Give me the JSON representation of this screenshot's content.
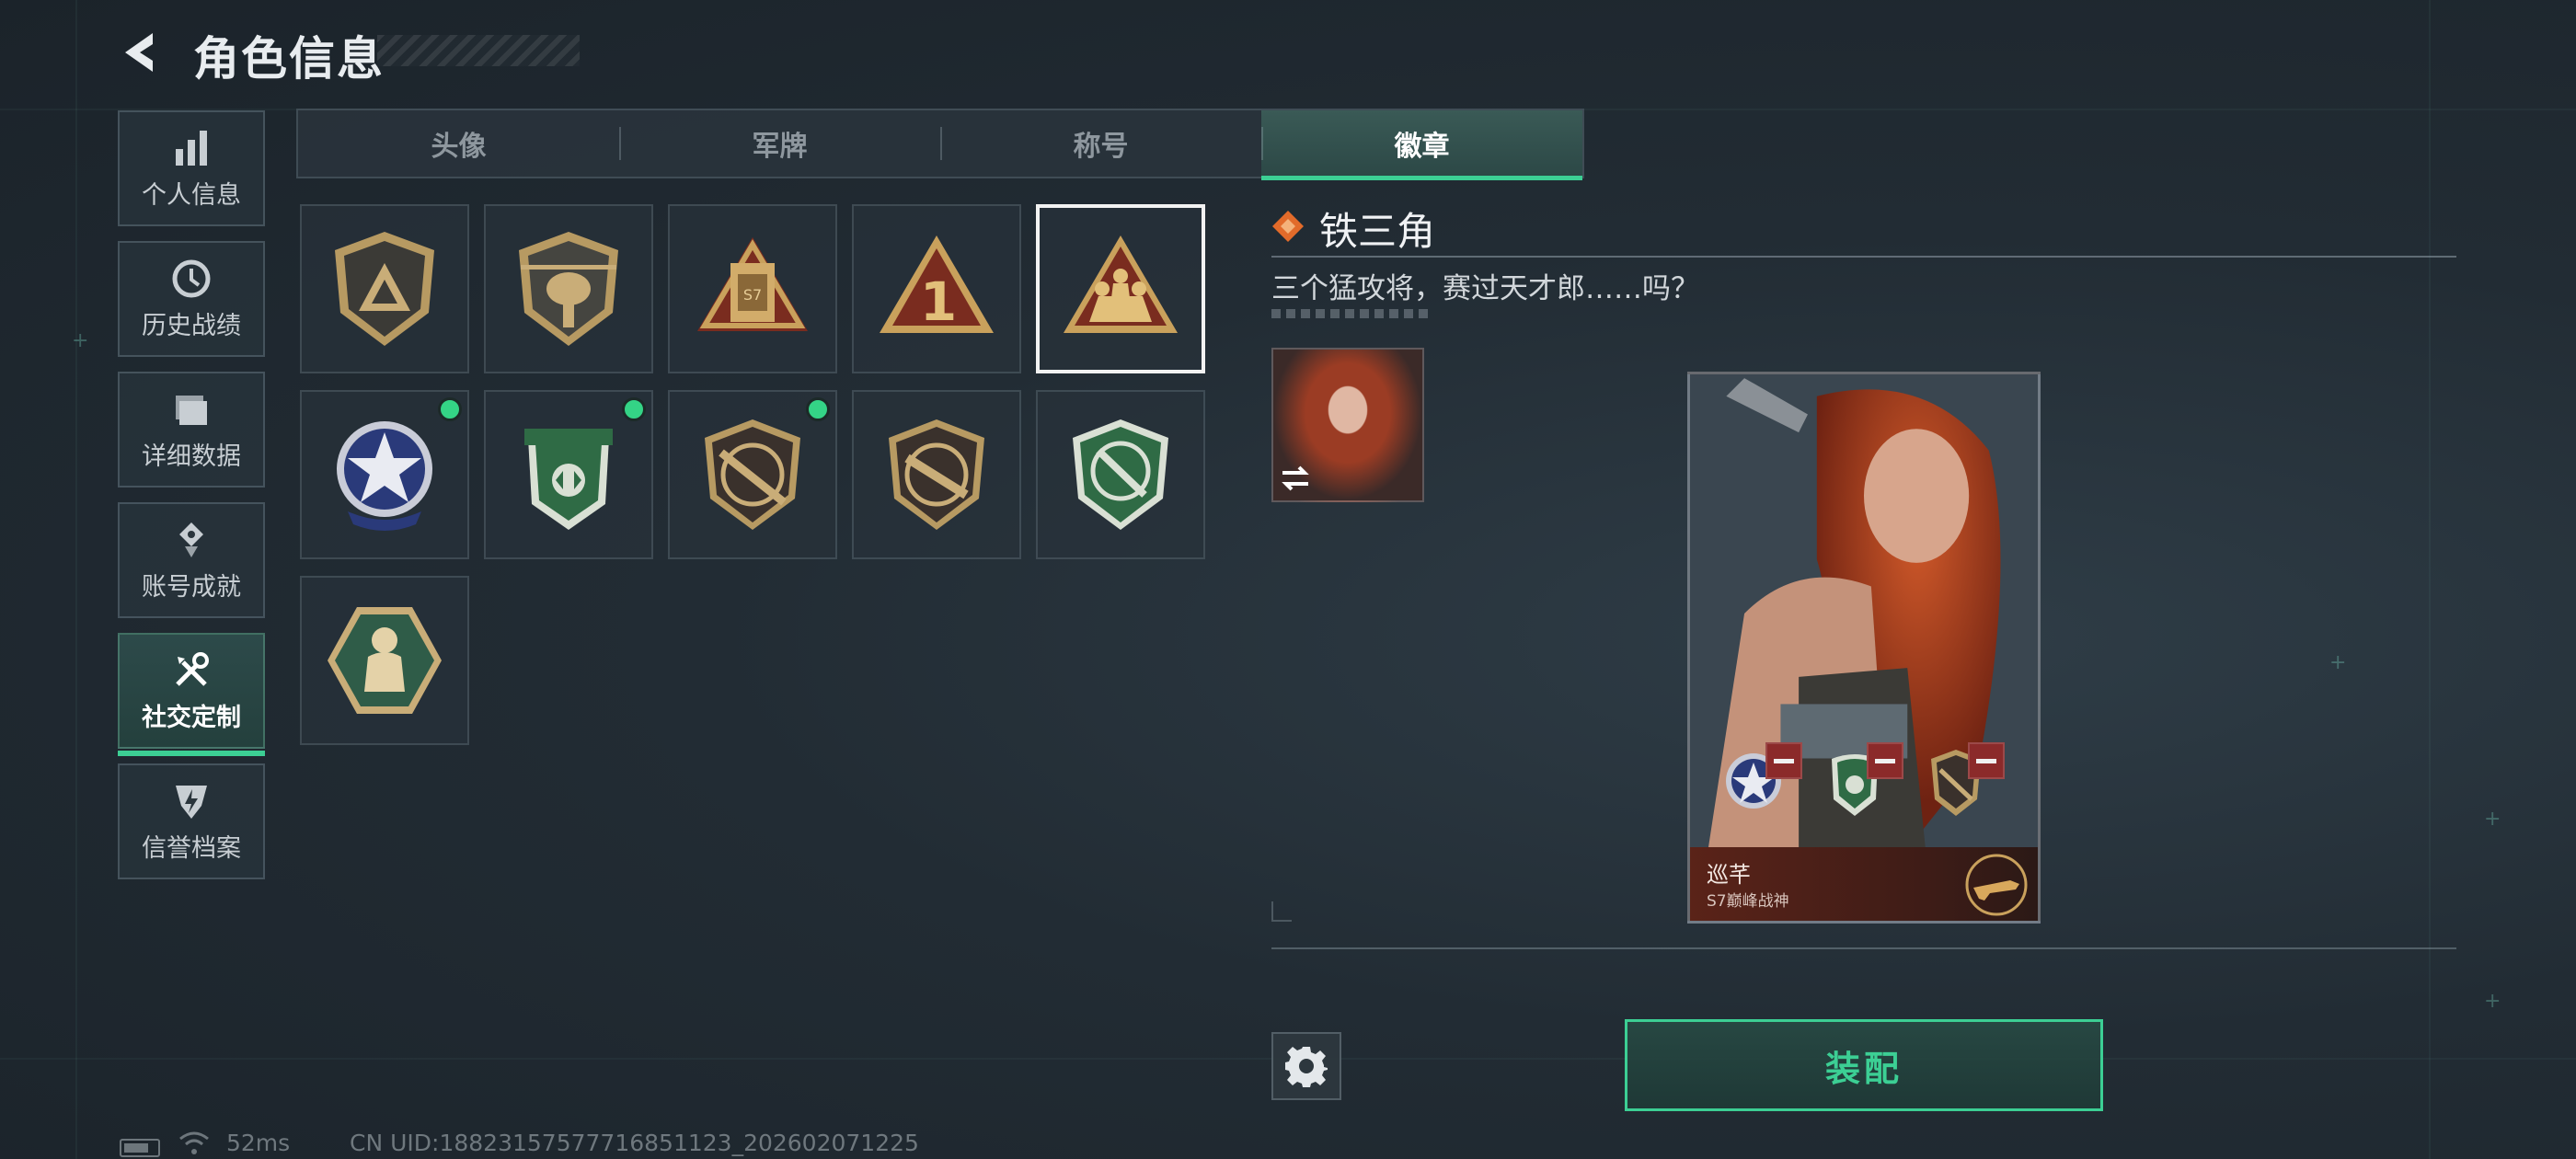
{
  "header": {
    "title": "角色信息"
  },
  "sidebar": {
    "items": [
      {
        "label": "个人信息",
        "icon": "bar-chart-icon",
        "active": false
      },
      {
        "label": "历史战绩",
        "icon": "clock-icon",
        "active": false
      },
      {
        "label": "详细数据",
        "icon": "folder-icon",
        "active": false
      },
      {
        "label": "账号成就",
        "icon": "achievement-icon",
        "active": false
      },
      {
        "label": "社交定制",
        "icon": "tools-icon",
        "active": true
      },
      {
        "label": "信誉档案",
        "icon": "shield-bolt-icon",
        "active": false
      }
    ]
  },
  "tabs": [
    {
      "label": "头像",
      "active": false
    },
    {
      "label": "军牌",
      "active": false
    },
    {
      "label": "称号",
      "active": false
    },
    {
      "label": "徽章",
      "active": true
    }
  ],
  "badges": [
    {
      "name": "triangle-shield-badge",
      "equipped": false,
      "selected": false
    },
    {
      "name": "helicopter-badge",
      "equipped": false,
      "selected": false
    },
    {
      "name": "s7-crate-badge",
      "equipped": false,
      "selected": false
    },
    {
      "name": "number-one-badge",
      "equipped": false,
      "selected": false
    },
    {
      "name": "iron-triangle-badge",
      "equipped": false,
      "selected": true
    },
    {
      "name": "star-skull-badge",
      "equipped": true,
      "selected": false
    },
    {
      "name": "green-shield-badge",
      "equipped": true,
      "selected": false
    },
    {
      "name": "rifle-crosshair-badge",
      "equipped": true,
      "selected": false
    },
    {
      "name": "smg-crosshair-badge",
      "equipped": false,
      "selected": false
    },
    {
      "name": "knife-crosshair-badge",
      "equipped": false,
      "selected": false
    },
    {
      "name": "hexagon-soldier-badge",
      "equipped": false,
      "selected": false
    }
  ],
  "detail": {
    "name": "铁三角",
    "description": "三个猛攻将，赛过天才郎……吗？"
  },
  "card": {
    "player_name": "巡芊",
    "player_title": "S7巅峰战神"
  },
  "actions": {
    "equip_label": "装配"
  },
  "status": {
    "ping": "52ms",
    "uid": "CN UID:18823157577716851123_202602071225"
  },
  "colors": {
    "accent": "#3ccf94",
    "selected_border": "#f2f2f2",
    "remove": "#8b2a2a"
  }
}
